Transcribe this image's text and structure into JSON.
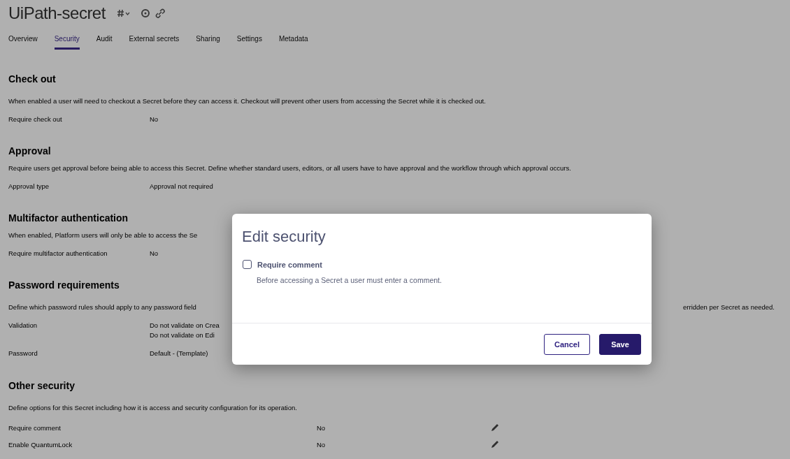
{
  "page": {
    "title": "UiPath-secret",
    "tabs": [
      {
        "label": "Overview",
        "selected": false
      },
      {
        "label": "Security",
        "selected": true
      },
      {
        "label": "Audit",
        "selected": false
      },
      {
        "label": "External secrets",
        "selected": false
      },
      {
        "label": "Sharing",
        "selected": false
      },
      {
        "label": "Settings",
        "selected": false
      },
      {
        "label": "Metadata",
        "selected": false
      }
    ],
    "sections": [
      {
        "heading": "Check out",
        "description": "When enabled a user will need to checkout a Secret before they can access it. Checkout will prevent other users from accessing the Secret while it is checked out.",
        "rows": [
          {
            "kind": "plain",
            "label": "Require check out",
            "values": [
              "No"
            ]
          }
        ]
      },
      {
        "heading": "Approval",
        "description": "Require users get approval before being able to access this Secret. Define whether standard users, editors, or all users have to have approval and the workflow through which approval occurs.",
        "rows": [
          {
            "kind": "plain",
            "label": "Approval type",
            "values": [
              "Approval not required"
            ]
          }
        ]
      },
      {
        "heading": "Multifactor authentication",
        "description": "When enabled, Platform users will only be able to access the Se",
        "rows": [
          {
            "kind": "plain",
            "label": "Require multifactor authentication",
            "values": [
              "No"
            ]
          }
        ]
      },
      {
        "heading": "Password requirements",
        "description": "Define which password rules should apply to any password field",
        "description_right": "erridden per Secret as needed.",
        "rows": [
          {
            "kind": "plain",
            "label": "Validation",
            "values": [
              "Do not validate on Crea",
              "Do not validate on Edi"
            ]
          },
          {
            "kind": "plain",
            "label": "Password",
            "values": [
              "Default - (Template)"
            ]
          }
        ]
      },
      {
        "heading": "Other security",
        "description": "Define options for this Secret including how it is access and security configuration for its operation.",
        "rows": [
          {
            "kind": "editable",
            "label": "Require comment",
            "values": [
              "No"
            ]
          },
          {
            "kind": "editable",
            "label": "Enable QuantumLock",
            "values": [
              "No"
            ]
          }
        ]
      }
    ]
  },
  "dialog": {
    "title": "Edit security",
    "option": {
      "label": "Require comment",
      "checked": false,
      "description": "Before accessing a Secret a user must enter a comment."
    },
    "buttons": [
      {
        "kind": "secondary",
        "label": "Cancel"
      },
      {
        "kind": "primary",
        "label": "Save"
      }
    ]
  }
}
